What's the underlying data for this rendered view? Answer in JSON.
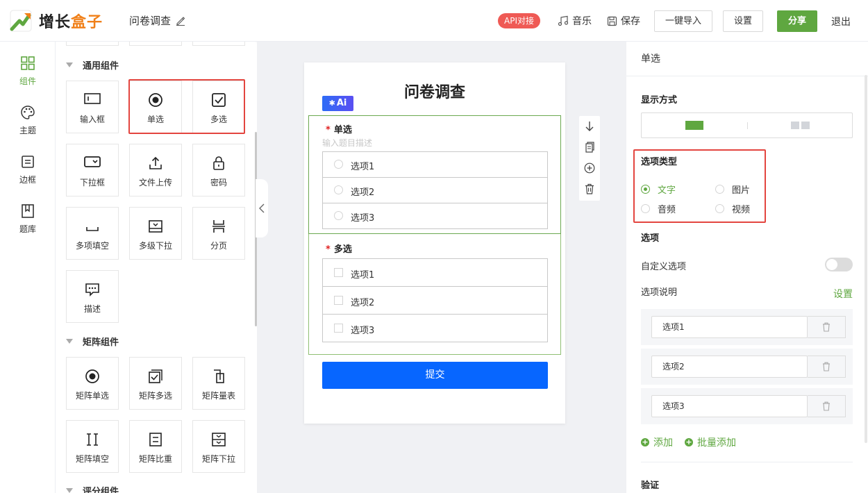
{
  "header": {
    "logo_part1": "增长",
    "logo_part2": "盒子",
    "doc_title": "问卷调查",
    "api_badge": "API对接",
    "music": "音乐",
    "save": "保存",
    "import": "一键导入",
    "settings": "设置",
    "share": "分享",
    "logout": "退出",
    "brand_color": "#5fa740",
    "accent_orange": "#f08019"
  },
  "leftnav": [
    {
      "label": "组件",
      "icon": "grid-icon",
      "active": true
    },
    {
      "label": "主题",
      "icon": "palette-icon"
    },
    {
      "label": "边框",
      "icon": "border-icon"
    },
    {
      "label": "题库",
      "icon": "library-icon"
    }
  ],
  "components": {
    "general_title": "通用组件",
    "general": [
      "输入框",
      "单选",
      "多选",
      "下拉框",
      "文件上传",
      "密码",
      "多项填空",
      "多级下拉",
      "分页",
      "描述"
    ],
    "matrix_title": "矩阵组件",
    "matrix": [
      "矩阵单选",
      "矩阵多选",
      "矩阵量表",
      "矩阵填空",
      "矩阵比重",
      "矩阵下拉"
    ],
    "rating_title": "评分组件"
  },
  "form": {
    "title": "问卷调查",
    "ai_badge": "Ai",
    "q1": {
      "required": "*",
      "label": "单选",
      "desc_placeholder": "输入题目描述",
      "options": [
        "选项1",
        "选项2",
        "选项3"
      ]
    },
    "q2": {
      "required": "*",
      "label": "多选",
      "options": [
        "选项1",
        "选项2",
        "选项3"
      ]
    },
    "submit": "提交",
    "submit_color": "#0766ff"
  },
  "panel": {
    "header": "单选",
    "display_mode_label": "显示方式",
    "option_type_label": "选项类型",
    "option_types": [
      "文字",
      "图片",
      "音频",
      "视频"
    ],
    "option_type_selected": "文字",
    "options_label": "选项",
    "custom_option_label": "自定义选项",
    "custom_option_on": false,
    "option_desc_label": "选项说明",
    "option_desc_link": "设置",
    "option_values": [
      "选项1",
      "选项2",
      "选项3"
    ],
    "add": "添加",
    "batch_add": "批量添加",
    "validation_label": "验证"
  }
}
